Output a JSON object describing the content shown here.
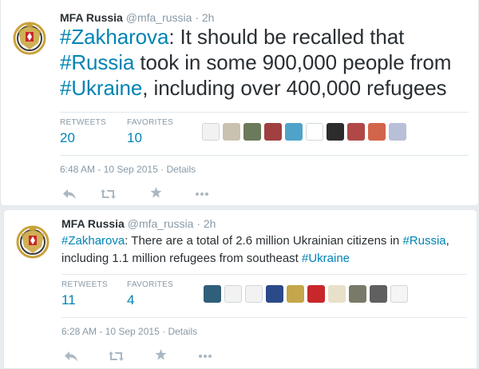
{
  "tweets": [
    {
      "fullname": "MFA Russia",
      "handle": "@mfa_russia",
      "dot": "·",
      "time": "2h",
      "text_parts": [
        {
          "hashtag": true,
          "value": "#Zakharova"
        },
        {
          "hashtag": false,
          "value": ": It should be recalled that "
        },
        {
          "hashtag": true,
          "value": "#Russia"
        },
        {
          "hashtag": false,
          "value": " took in some 900,000 people from "
        },
        {
          "hashtag": true,
          "value": "#Ukraine"
        },
        {
          "hashtag": false,
          "value": ", including over 400,000 refugees"
        }
      ],
      "retweets_label": "RETWEETS",
      "retweets_count": "20",
      "favorites_label": "FAVORITES",
      "favorites_count": "10",
      "favoriter_avatar_colors": [
        "#f2f2f2",
        "#c9c2b0",
        "#6b7a5a",
        "#a04040",
        "#4fa3c9",
        "#ffffff",
        "#2c2c2c",
        "#b04848",
        "#d2644a",
        "#b8c0d8"
      ],
      "timestamp": "6:48 AM - 10 Sep 2015",
      "separator": "·",
      "details_label": "Details"
    },
    {
      "fullname": "MFA Russia",
      "handle": "@mfa_russia",
      "dot": "·",
      "time": "2h",
      "text_parts": [
        {
          "hashtag": true,
          "value": "#Zakharova"
        },
        {
          "hashtag": false,
          "value": ": There are a total of 2.6 million Ukrainian citizens in "
        },
        {
          "hashtag": true,
          "value": "#Russia"
        },
        {
          "hashtag": false,
          "value": ", including 1.1 million refugees from southeast "
        },
        {
          "hashtag": true,
          "value": "#Ukraine"
        }
      ],
      "retweets_label": "RETWEETS",
      "retweets_count": "11",
      "favorites_label": "FAVORITES",
      "favorites_count": "4",
      "favoriter_avatar_colors": [
        "#2f5f7a",
        "#f2f2f2",
        "#f2f2f2",
        "#2a4a8a",
        "#c6a64a",
        "#c8282a",
        "#e8e0c8",
        "#7a7a6a",
        "#606060",
        "#f5f5f5"
      ],
      "timestamp": "6:28 AM - 10 Sep 2015",
      "separator": "·",
      "details_label": "Details"
    }
  ],
  "icons": {
    "reply": "reply-icon",
    "retweet": "retweet-icon",
    "favorite": "favorite-star-icon",
    "more": "more-dots-icon"
  },
  "colors": {
    "link": "#0084b4",
    "text": "#292f33",
    "muted": "#8899a6",
    "action_icon": "#aab8c2",
    "background": "#e9ecee"
  }
}
